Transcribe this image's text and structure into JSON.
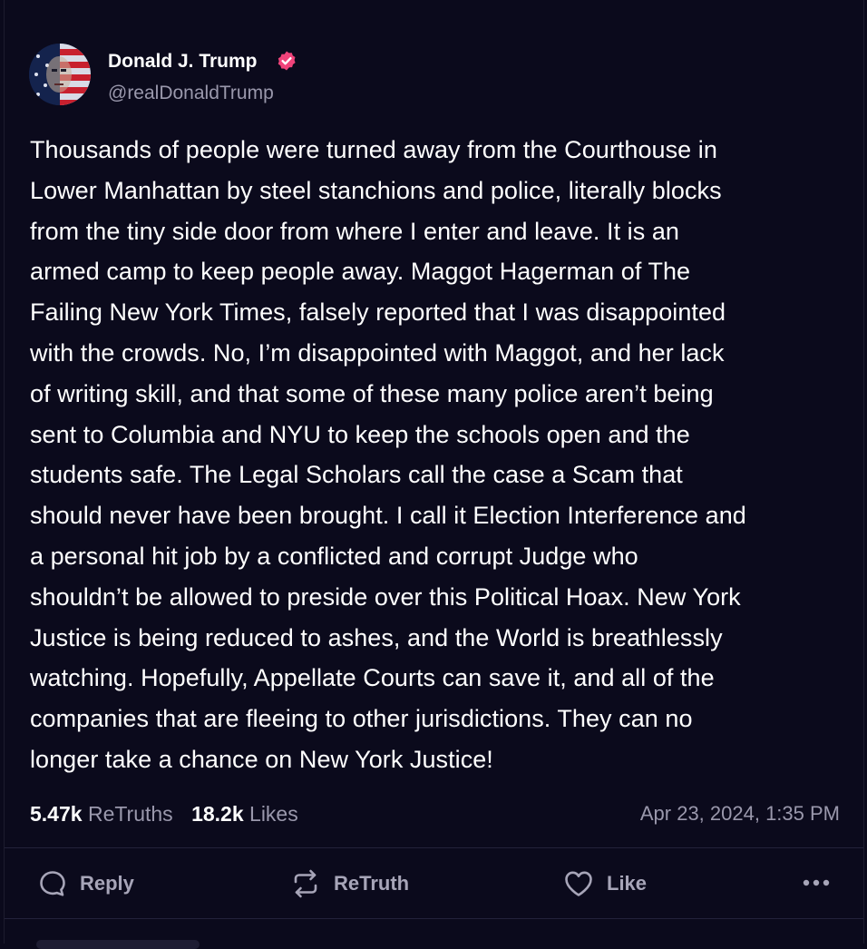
{
  "post": {
    "author_name": "Donald J. Trump",
    "author_handle": "@realDonaldTrump",
    "body_lines": [
      "Thousands of people were turned away from the Courthouse in",
      "Lower Manhattan by steel stanchions and police, literally blocks",
      "from the tiny side door from where I enter and leave. It is an",
      "armed camp to keep people away. Maggot Hagerman of The",
      "Failing New York Times, falsely reported that I was disappointed",
      "with the crowds. No, I’m disappointed with Maggot, and her lack",
      "of writing skill, and that some of these many police aren’t being",
      "sent to Columbia and NYU to keep the schools open and the",
      "students safe. The Legal Scholars call the case a Scam that",
      "should never have been brought. I call it Election Interference and",
      "a personal hit job by a conflicted and corrupt Judge who",
      "shouldn’t be allowed to preside over this Political Hoax. New York",
      "Justice is being reduced to ashes, and the World is breathlessly",
      "watching. Hopefully, Appellate Courts can save it, and all of the",
      "companies that are fleeing to other jurisdictions. They can no",
      "longer take a chance on New York Justice!"
    ]
  },
  "stats": {
    "retruths_count": "5.47k",
    "retruths_label": "ReTruths",
    "likes_count": "18.2k",
    "likes_label": "Likes",
    "timestamp": "Apr 23, 2024, 1:35 PM"
  },
  "actions": {
    "reply_label": "Reply",
    "retruth_label": "ReTruth",
    "like_label": "Like"
  },
  "icons": {
    "verified": "verified-badge-icon",
    "reply": "reply-bubble-icon",
    "retruth": "retruth-arrows-icon",
    "like": "heart-icon",
    "more": "more-dots-icon"
  },
  "colors": {
    "background": "#0b0a1c",
    "verified_badge": "#f0437a",
    "muted_text": "#9a98ac",
    "action_text": "#a7a5b8"
  }
}
